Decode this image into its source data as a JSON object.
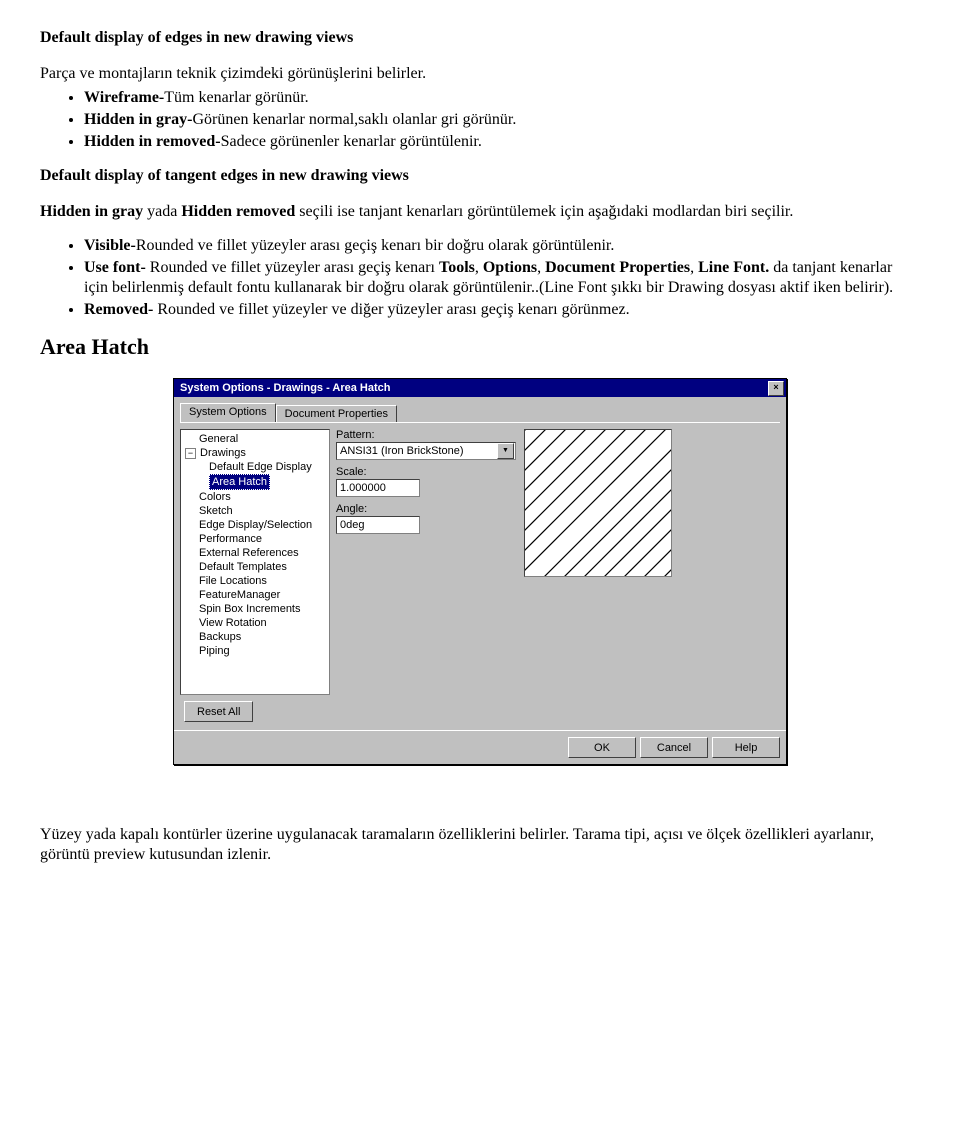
{
  "doc": {
    "h1": "Default display of edges in new drawing views",
    "p1": "Parça ve montajların teknik çizimdeki görünüşlerini belirler.",
    "b1a": "Wireframe-",
    "b1b": "Tüm kenarlar görünür.",
    "b2a": "Hidden in gray-",
    "b2b": "Görünen kenarlar normal,saklı olanlar gri görünür.",
    "b3a": "Hidden in removed-",
    "b3b": "Sadece görünenler kenarlar görüntülenir.",
    "h2": "Default display of tangent edges in new drawing views",
    "p2a": "Hidden in gray",
    "p2mid": " yada ",
    "p2b": "Hidden removed",
    "p2c": " seçili ise tanjant kenarları görüntülemek için aşağıdaki modlardan biri seçilir.",
    "b4a": "Visible-",
    "b4b": "Rounded ve fillet yüzeyler arası geçiş kenarı bir doğru olarak görüntülenir.",
    "b5a": "Use font-",
    "b5b": " Rounded ve fillet yüzeyler arası geçiş kenarı ",
    "b5c": "Tools",
    "b5d": ", ",
    "b5e": "Options",
    "b5f": ", ",
    "b5g": "Document Properties",
    "b5h": ", ",
    "b5i": "Line Font.",
    "b5j": " da tanjant kenarlar için belirlenmiş default fontu kullanarak bir doğru olarak görüntülenir..(Line Font şıkkı bir Drawing dosyası aktif iken belirir).",
    "b6a": "Removed-",
    "b6b": " Rounded ve fillet yüzeyler ve diğer yüzeyler arası geçiş kenarı görünmez.",
    "area_hatch": "Area Hatch",
    "p_last": "Yüzey yada kapalı kontürler üzerine uygulanacak taramaların özelliklerini belirler. Tarama tipi, açısı ve ölçek özellikleri ayarlanır, görüntü preview kutusundan izlenir."
  },
  "dialog": {
    "title": "System Options - Drawings - Area Hatch",
    "close": "×",
    "tabs": {
      "active": "System Options",
      "inactive": "Document Properties"
    },
    "tree": {
      "items": [
        {
          "label": "General",
          "level": 1
        },
        {
          "label": "Drawings",
          "level": 1,
          "expandable": true,
          "collapsed": false
        },
        {
          "label": "Default Edge Display",
          "level": 2
        },
        {
          "label": "Area Hatch",
          "level": 2,
          "selected": true
        },
        {
          "label": "Colors",
          "level": 1
        },
        {
          "label": "Sketch",
          "level": 1
        },
        {
          "label": "Edge Display/Selection",
          "level": 1
        },
        {
          "label": "Performance",
          "level": 1
        },
        {
          "label": "External References",
          "level": 1
        },
        {
          "label": "Default Templates",
          "level": 1
        },
        {
          "label": "File Locations",
          "level": 1
        },
        {
          "label": "FeatureManager",
          "level": 1
        },
        {
          "label": "Spin Box Increments",
          "level": 1
        },
        {
          "label": "View Rotation",
          "level": 1
        },
        {
          "label": "Backups",
          "level": 1
        },
        {
          "label": "Piping",
          "level": 1
        }
      ]
    },
    "fields": {
      "pattern_label": "Pattern:",
      "pattern_value": "ANSI31 (Iron BrickStone)",
      "scale_label": "Scale:",
      "scale_value": "1.000000",
      "angle_label": "Angle:",
      "angle_value": "0deg"
    },
    "buttons": {
      "reset": "Reset All",
      "ok": "OK",
      "cancel": "Cancel",
      "help": "Help"
    }
  }
}
